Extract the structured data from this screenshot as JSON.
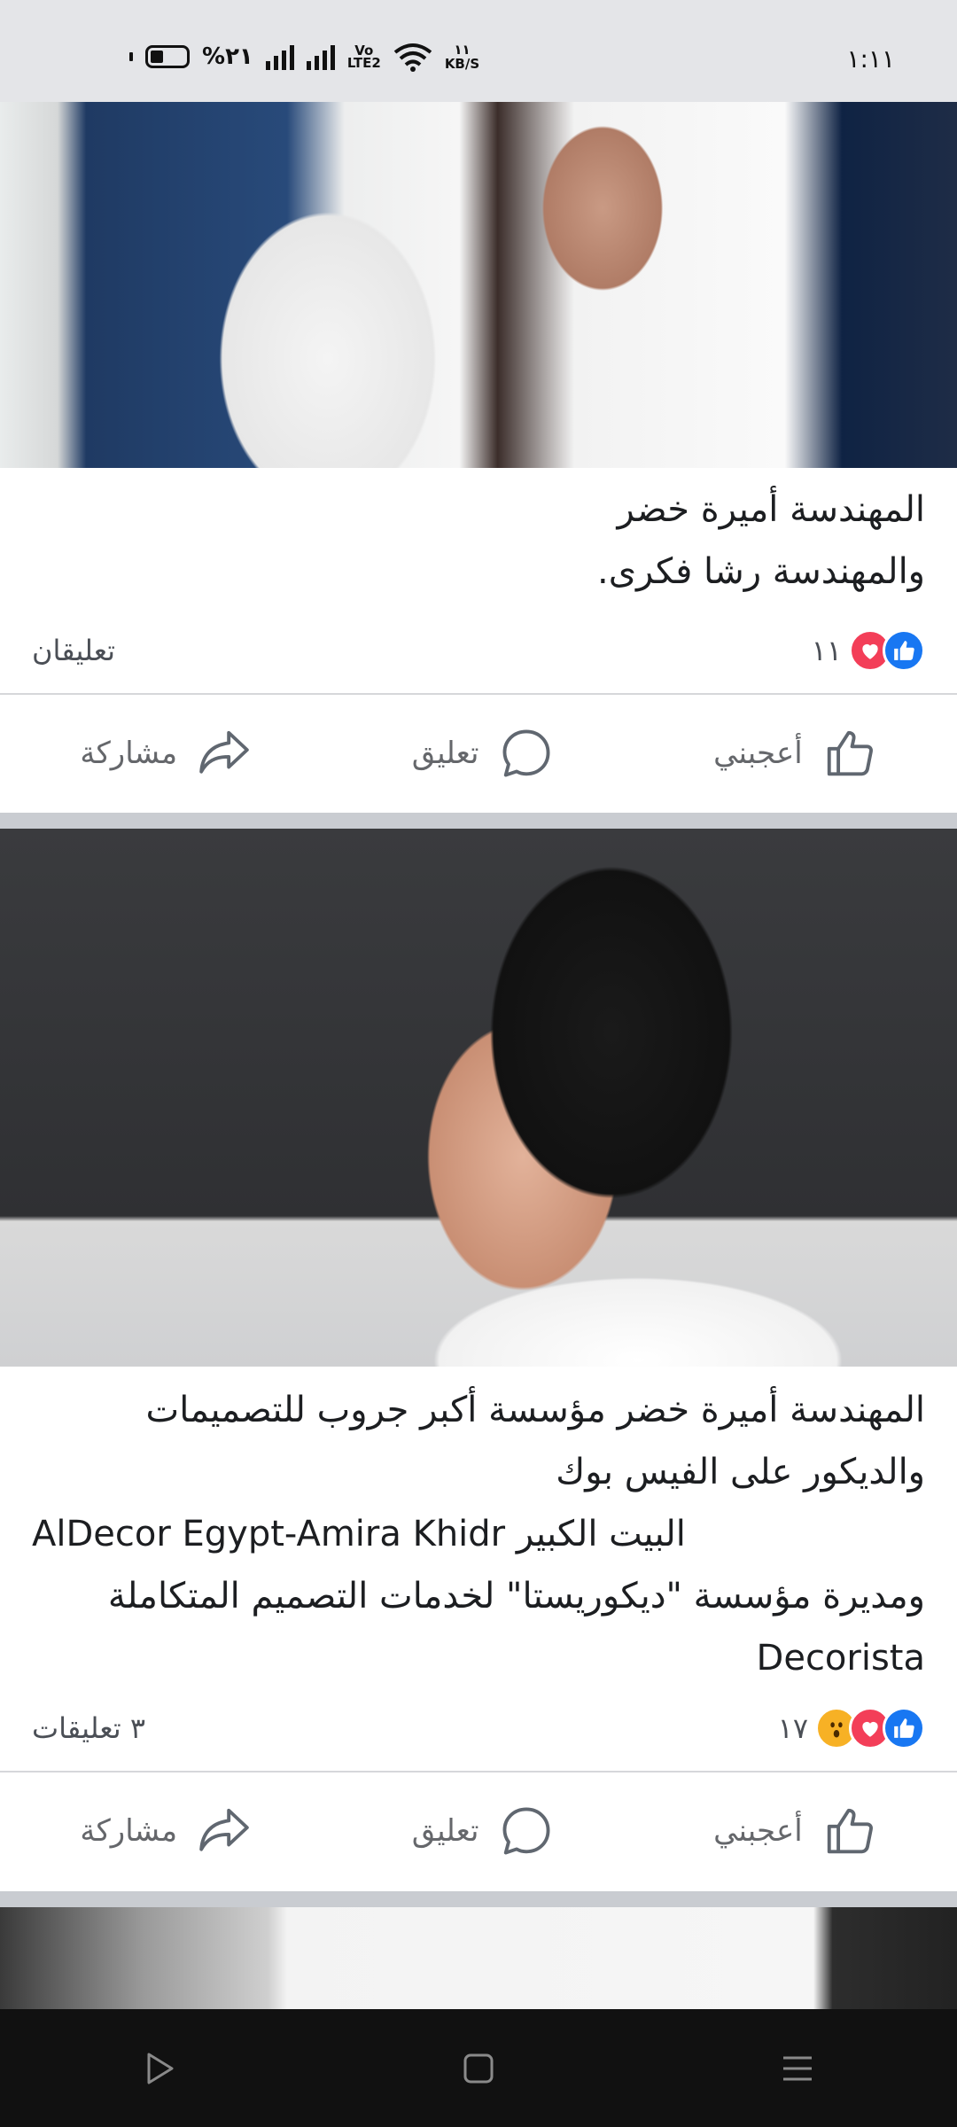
{
  "status_bar": {
    "battery_text": "%٢١",
    "volte_top": "Vo",
    "volte_bottom": "LTE2",
    "speed_value": "١١",
    "speed_unit": "KB/S",
    "time": "١:١١"
  },
  "posts": [
    {
      "caption_lines": [
        "المهندسة أميرة خضر",
        "والمهندسة رشا فكرى."
      ],
      "reaction_count": "١١",
      "reaction_icons": [
        "like-icon",
        "love-icon"
      ],
      "comments_label": "تعليقان"
    },
    {
      "caption_lines": [
        "المهندسة أميرة خضر مؤسسة أكبر جروب للتصميمات",
        "والديكور على الفيس بوك",
        "البيت الكبير AlDecor Egypt-Amira Khidr",
        "ومديرة مؤسسة \"ديكوريستا\" لخدمات التصميم المتكاملة",
        "Decorista"
      ],
      "reaction_count": "١٧",
      "reaction_icons": [
        "like-icon",
        "love-icon",
        "wow-icon"
      ],
      "comments_label": "٣ تعليقات"
    }
  ],
  "actions": {
    "like": "أعجبني",
    "comment": "تعليق",
    "share": "مشاركة"
  },
  "nav": {
    "back": "back-icon",
    "home": "home-icon",
    "recents": "menu-icon"
  },
  "colors": {
    "like_blue": "#1877f2",
    "love_red": "#f33e58",
    "wow_yellow": "#f7b125"
  }
}
